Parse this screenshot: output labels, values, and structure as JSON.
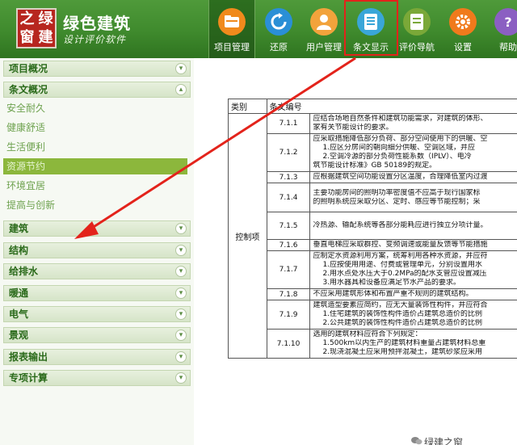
{
  "app": {
    "logo_chars": [
      "之",
      "绿",
      "窗",
      "建"
    ],
    "title": "绿色建筑",
    "subtitle": "设计评价软件"
  },
  "toolbar": [
    {
      "label": "项目管理",
      "icon": "folder-icon",
      "color": "#f08a1c"
    },
    {
      "label": "还原",
      "icon": "refresh-icon",
      "color": "#2a8fd6"
    },
    {
      "label": "用户管理",
      "icon": "user-icon",
      "color": "#f2a33c"
    },
    {
      "label": "条文显示",
      "icon": "document-icon",
      "color": "#3aa6d8"
    },
    {
      "label": "评价导航",
      "icon": "book-icon",
      "color": "#7aa838"
    },
    {
      "label": "设置",
      "icon": "gear-icon",
      "color": "#f07a1c"
    },
    {
      "label": "帮助",
      "icon": "help-icon",
      "color": "#8b5fc2"
    }
  ],
  "sidebar": {
    "sections": [
      {
        "label": "项目概况"
      },
      {
        "label": "条文概况"
      },
      {
        "label": "建筑"
      },
      {
        "label": "结构"
      },
      {
        "label": "给排水"
      },
      {
        "label": "暖通"
      },
      {
        "label": "电气"
      },
      {
        "label": "景观"
      },
      {
        "label": "报表输出"
      },
      {
        "label": "专项计算"
      }
    ],
    "subitems": [
      {
        "label": "安全耐久"
      },
      {
        "label": "健康舒适"
      },
      {
        "label": "生活便利"
      },
      {
        "label": "资源节约"
      },
      {
        "label": "环境宜居"
      },
      {
        "label": "提高与创新"
      }
    ]
  },
  "table": {
    "headers": [
      "类别",
      "条文编号"
    ],
    "category": "控制项",
    "rows": [
      {
        "num": "7.1.1",
        "lines": [
          "应结合场地自然条件和建筑功能需求，对建筑的体形、",
          "家有关节能设计的要求。"
        ]
      },
      {
        "num": "7.1.2",
        "lines": [
          "应采取措施降低部分负荷、部分空间使用下的供暖、空",
          "1.应区分房间的朝向细分供暖、空调区域，并应",
          "2.空调冷源的部分负荷性能系数（IPLV）、电冷",
          "筑节能设计标准》GB 50189的规定。"
        ]
      },
      {
        "num": "7.1.3",
        "lines": [
          "应根据建筑空间功能设置分区温度，合理降低室内过渡"
        ]
      },
      {
        "num": "7.1.4",
        "lines": [
          "主要功能房间的照明功率密度值不应高于现行国家标",
          "的照明系统应采取分区、定时、感应等节能控制；采"
        ]
      },
      {
        "num": "7.1.5",
        "lines": [
          "冷热源、输配系统等各部分能耗应进行独立分项计量。"
        ]
      },
      {
        "num": "7.1.6",
        "lines": [
          "垂直电梯应采取群控、变频调速或能量反馈等节能措施"
        ]
      },
      {
        "num": "7.1.7",
        "lines": [
          "应制定水资源利用方案，统筹利用各种水资源，并应符",
          "1.应按使用用途、付费或管理单元，分别设置用水",
          "2.用水点处水压大于0.2MPa的配水支管应设置减压",
          "3.用水器具和设备应满足节水产品的要求。"
        ]
      },
      {
        "num": "7.1.8",
        "lines": [
          "不应采用建筑形体和布置严重不规则的建筑结构。"
        ]
      },
      {
        "num": "7.1.9",
        "lines": [
          "建筑造型要素应简约，应无大量装饰性构件，并应符合",
          "1.住宅建筑的装饰性构件造价占建筑总造价的比例",
          "2.公共建筑的装饰性构件造价占建筑总造价的比例"
        ]
      },
      {
        "num": "7.1.10",
        "lines": [
          "选用的建筑材料应符合下列规定：",
          "1.500km以内生产的建筑材料重量占建筑材料总重",
          "2.现浇混凝土应采用预拌混凝土，建筑砂浆应采用"
        ]
      }
    ]
  },
  "watermark": "绿建之窗",
  "colors": {
    "header_green": "#3f8a2d",
    "highlight_red": "#e3231b",
    "active_item": "#8cb73c",
    "section_text": "#2a6a1a"
  }
}
